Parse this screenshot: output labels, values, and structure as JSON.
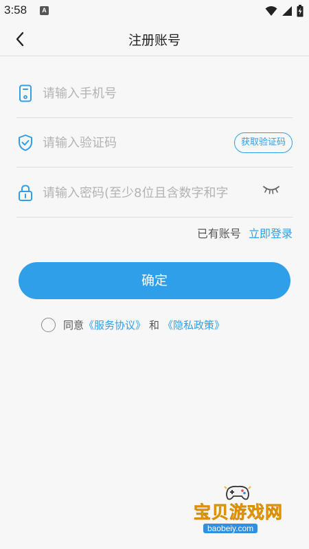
{
  "status_bar": {
    "time": "3:58",
    "notification_letter": "A"
  },
  "header": {
    "title": "注册账号"
  },
  "form": {
    "phone": {
      "placeholder": "请输入手机号",
      "value": ""
    },
    "code": {
      "placeholder": "请输入验证码",
      "value": "",
      "get_code_label": "获取验证码"
    },
    "password": {
      "placeholder": "请输入密码(至少8位且含数字和字",
      "value": ""
    }
  },
  "login_hint": {
    "text": "已有账号",
    "link": "立即登录"
  },
  "confirm_label": "确定",
  "agreement": {
    "prefix": "同意",
    "service_link": "《服务协议》",
    "and": "和",
    "privacy_link": "《隐私政策》",
    "checked": false
  },
  "watermark": {
    "brand": "宝贝游戏网",
    "url": "baobeiy.com"
  },
  "colors": {
    "accent": "#2f9fe9",
    "background": "#f7f7f7",
    "placeholder": "#b3b3b3"
  }
}
